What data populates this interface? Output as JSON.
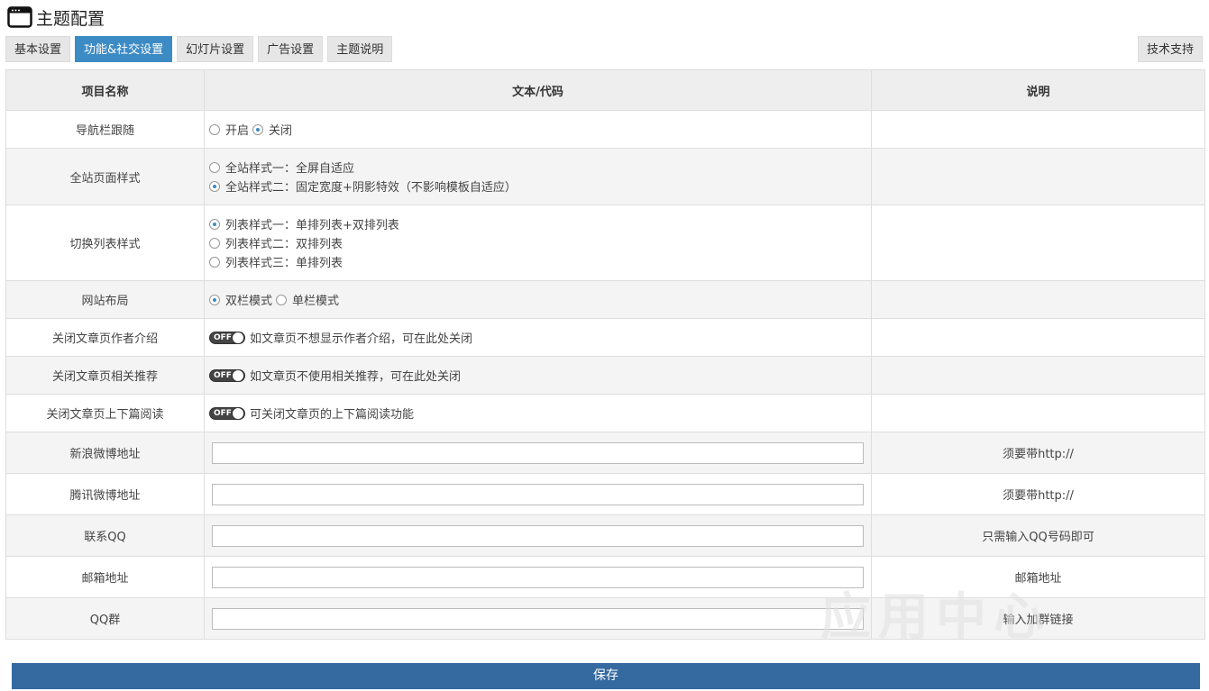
{
  "header": {
    "title": "主题配置",
    "icon": "window-icon"
  },
  "tabs": [
    {
      "label": "基本设置",
      "active": false
    },
    {
      "label": "功能&社交设置",
      "active": true
    },
    {
      "label": "幻灯片设置",
      "active": false
    },
    {
      "label": "广告设置",
      "active": false
    },
    {
      "label": "主题说明",
      "active": false
    }
  ],
  "support_label": "技术支持",
  "table": {
    "headers": [
      "项目名称",
      "文本/代码",
      "说明"
    ],
    "rows": [
      {
        "name": "导航栏跟随",
        "options": [
          "开启",
          "关闭"
        ],
        "selected": "关闭"
      },
      {
        "name": "全站页面样式",
        "options": [
          "全站样式一：全屏自适应",
          "全站样式二：固定宽度+阴影特效（不影响模板自适应）"
        ],
        "selected": "全站样式二：固定宽度+阴影特效（不影响模板自适应）"
      },
      {
        "name": "切换列表样式",
        "options": [
          "列表样式一：单排列表+双排列表",
          "列表样式二：双排列表",
          "列表样式三：单排列表"
        ],
        "selected": "列表样式一：单排列表+双排列表"
      },
      {
        "name": "网站布局",
        "options": [
          "双栏模式",
          "单栏模式"
        ],
        "selected": "双栏模式"
      },
      {
        "name": "关闭文章页作者介绍",
        "toggle_label": "OFF",
        "text": "如文章页不想显示作者介绍，可在此处关闭"
      },
      {
        "name": "关闭文章页相关推荐",
        "toggle_label": "OFF",
        "text": "如文章页不使用相关推荐，可在此处关闭"
      },
      {
        "name": "关闭文章页上下篇阅读",
        "toggle_label": "OFF",
        "text": "可关闭文章页的上下篇阅读功能"
      },
      {
        "name": "新浪微博地址",
        "value": "",
        "note": "须要带http://"
      },
      {
        "name": "腾讯微博地址",
        "value": "",
        "note": "须要带http://"
      },
      {
        "name": "联系QQ",
        "value": "",
        "note": "只需输入QQ号码即可"
      },
      {
        "name": "邮箱地址",
        "value": "",
        "note": "邮箱地址"
      },
      {
        "name": "QQ群",
        "value": "",
        "note": "输入加群链接"
      }
    ]
  },
  "save_label": "保存",
  "watermark": "应用中心"
}
